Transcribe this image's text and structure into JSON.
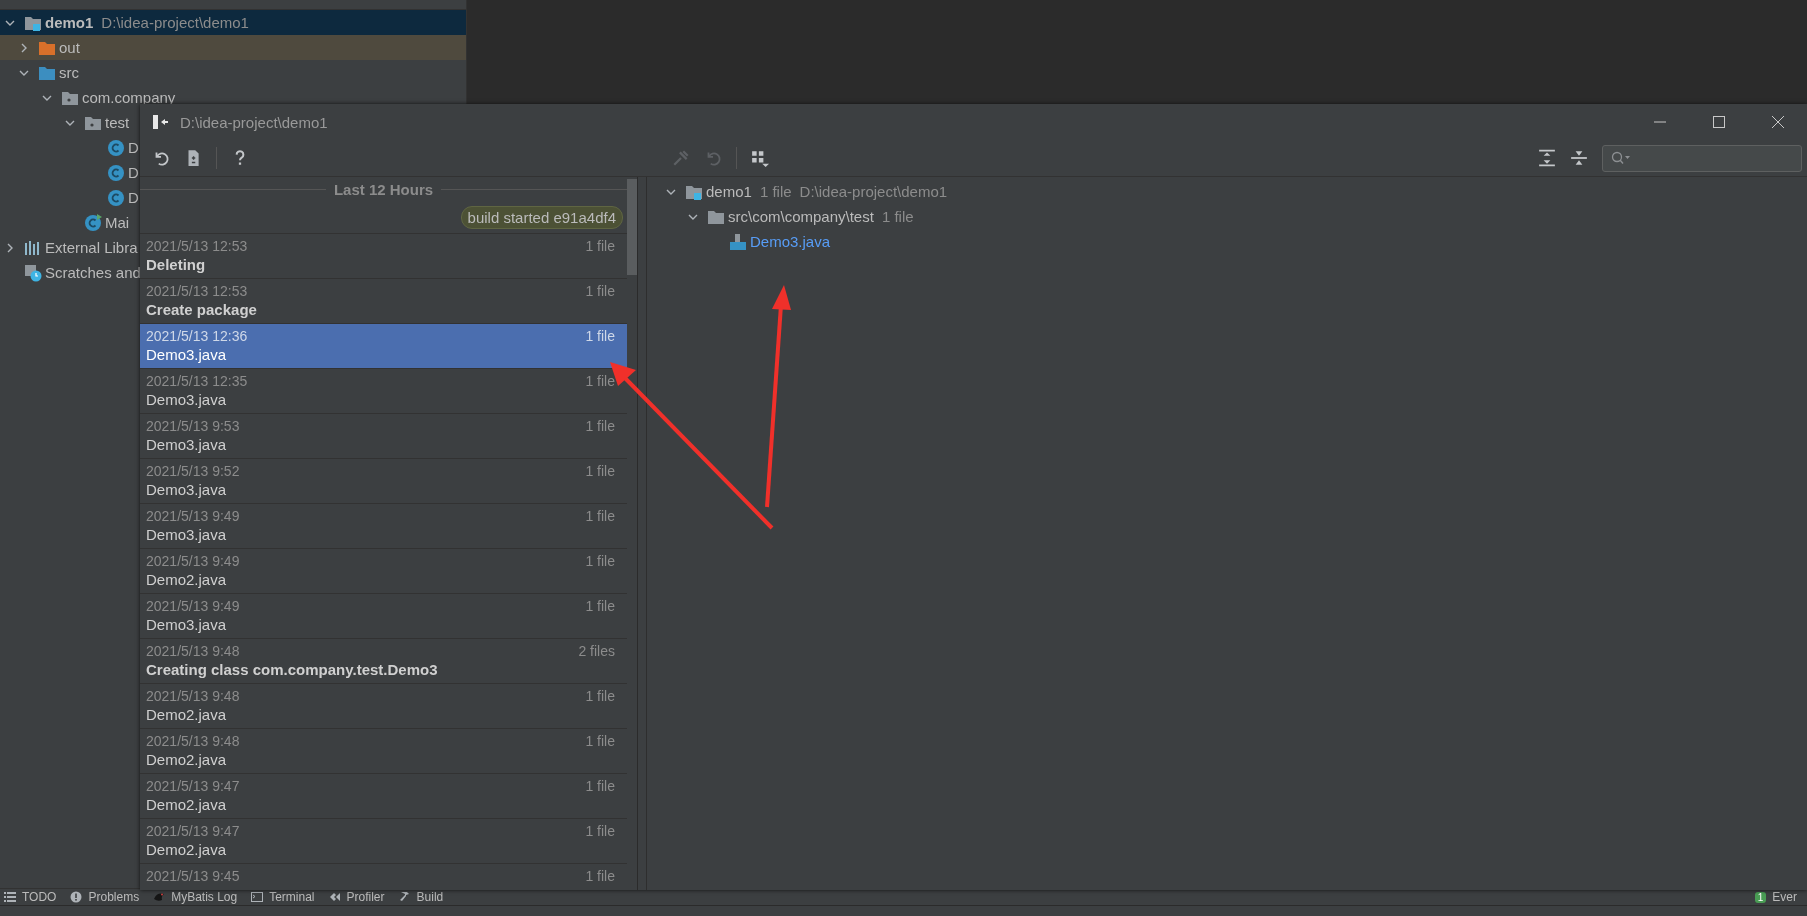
{
  "project_tree": [
    {
      "label": "demo1",
      "path": "D:\\idea-project\\demo1",
      "kind": "module",
      "expanded": true,
      "selected": true,
      "children": [
        {
          "label": "out",
          "kind": "excluded",
          "expanded": false,
          "selected": false
        },
        {
          "label": "src",
          "kind": "source",
          "expanded": true,
          "selected": false,
          "children": [
            {
              "label": "com.company",
              "kind": "package",
              "expanded": true,
              "selected": false,
              "children": [
                {
                  "label": "test",
                  "kind": "package",
                  "expanded": true,
                  "selected": false,
                  "children": [
                    {
                      "label": "D",
                      "kind": "class",
                      "selected": false
                    },
                    {
                      "label": "D",
                      "kind": "class",
                      "selected": false
                    },
                    {
                      "label": "D",
                      "kind": "class",
                      "selected": false
                    }
                  ]
                },
                {
                  "label": "Mai",
                  "kind": "main",
                  "selected": false
                }
              ]
            }
          ]
        }
      ]
    },
    {
      "label": "External Libra",
      "kind": "libraries",
      "expanded": false,
      "selected": false
    },
    {
      "label": "Scratches and",
      "kind": "scratches",
      "selected": false
    }
  ],
  "dialog": {
    "title": "D:\\idea-project\\demo1",
    "history_header": "Last 12 Hours",
    "build_label": "build started e91a4df4",
    "entries": [
      {
        "time": "2021/5/13 12:53",
        "count": "1 file",
        "name": "Deleting",
        "kind": "action",
        "selected": false
      },
      {
        "time": "2021/5/13 12:53",
        "count": "1 file",
        "name": "Create package",
        "kind": "action",
        "selected": false
      },
      {
        "time": "2021/5/13 12:36",
        "count": "1 file",
        "name": "Demo3.java",
        "kind": "file",
        "selected": true
      },
      {
        "time": "2021/5/13 12:35",
        "count": "1 file",
        "name": "Demo3.java",
        "kind": "file",
        "selected": false
      },
      {
        "time": "2021/5/13 9:53",
        "count": "1 file",
        "name": "Demo3.java",
        "kind": "file",
        "selected": false
      },
      {
        "time": "2021/5/13 9:52",
        "count": "1 file",
        "name": "Demo3.java",
        "kind": "file",
        "selected": false
      },
      {
        "time": "2021/5/13 9:49",
        "count": "1 file",
        "name": "Demo3.java",
        "kind": "file",
        "selected": false
      },
      {
        "time": "2021/5/13 9:49",
        "count": "1 file",
        "name": "Demo2.java",
        "kind": "file",
        "selected": false
      },
      {
        "time": "2021/5/13 9:49",
        "count": "1 file",
        "name": "Demo3.java",
        "kind": "file",
        "selected": false
      },
      {
        "time": "2021/5/13 9:48",
        "count": "2 files",
        "name": "Creating class com.company.test.Demo3",
        "kind": "action",
        "selected": false
      },
      {
        "time": "2021/5/13 9:48",
        "count": "1 file",
        "name": "Demo2.java",
        "kind": "file",
        "selected": false
      },
      {
        "time": "2021/5/13 9:48",
        "count": "1 file",
        "name": "Demo2.java",
        "kind": "file",
        "selected": false
      },
      {
        "time": "2021/5/13 9:47",
        "count": "1 file",
        "name": "Demo2.java",
        "kind": "file",
        "selected": false
      },
      {
        "time": "2021/5/13 9:47",
        "count": "1 file",
        "name": "Demo2.java",
        "kind": "file",
        "selected": false
      },
      {
        "time": "2021/5/13 9:45",
        "count": "1 file",
        "selected": false
      }
    ],
    "changes_tree": [
      {
        "label": "demo1",
        "count": "1 file",
        "path": "D:\\idea-project\\demo1",
        "kind": "module",
        "expanded": true,
        "children": [
          {
            "label": "src\\com\\company\\test",
            "count": "1 file",
            "kind": "folder",
            "expanded": true,
            "children": [
              {
                "label": "Demo3.java",
                "kind": "file"
              }
            ]
          }
        ]
      }
    ]
  },
  "tool_bar": [
    {
      "label": "TODO",
      "kind": "list"
    },
    {
      "label": "Problems",
      "kind": "problems"
    },
    {
      "label": "MyBatis Log",
      "kind": "mybatis"
    },
    {
      "label": "Terminal",
      "kind": "terminal"
    },
    {
      "label": "Profiler",
      "kind": "profiler"
    },
    {
      "label": "Build",
      "kind": "build"
    }
  ],
  "event_log": {
    "badge": "1",
    "label": "Ever"
  }
}
